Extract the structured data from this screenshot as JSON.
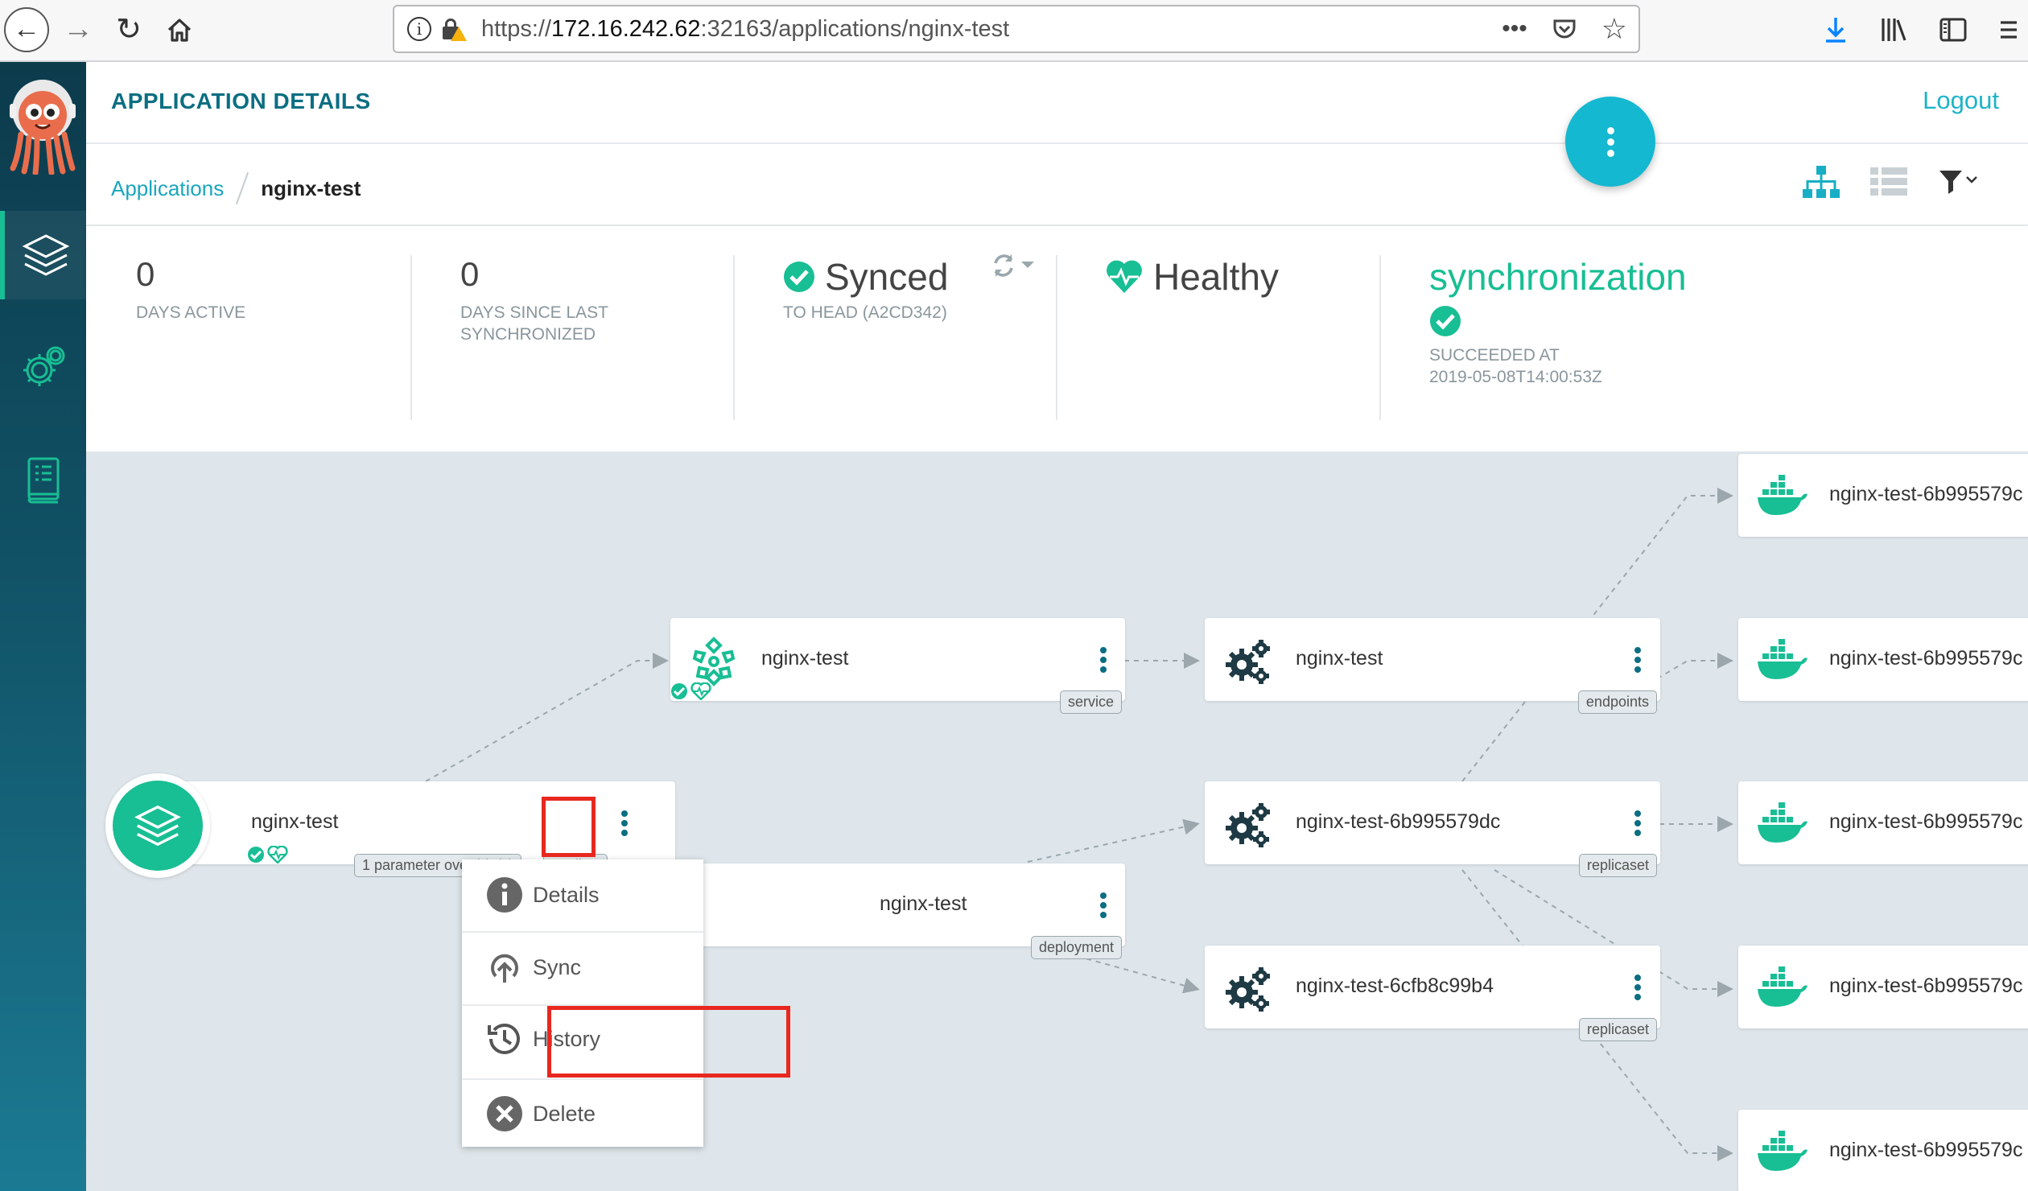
{
  "browser": {
    "url_scheme": "https://",
    "url_host": "172.16.242.62",
    "url_path": ":32163/applications/nginx-test",
    "more_actions": "•••",
    "icons": [
      "back-icon",
      "forward-icon",
      "reload-icon",
      "home-icon",
      "info-icon",
      "insecure-lock-icon",
      "pocket-icon",
      "bookmark-star-icon",
      "download-icon",
      "library-icon",
      "sidebar-icon",
      "menu-icon"
    ]
  },
  "sidebar": {
    "items": [
      {
        "name": "applications",
        "icon": "layers-icon",
        "active": true
      },
      {
        "name": "settings",
        "icon": "gear-icon",
        "active": false
      },
      {
        "name": "docs",
        "icon": "book-icon",
        "active": false
      }
    ]
  },
  "header": {
    "title": "APPLICATION DETAILS",
    "logout": "Logout"
  },
  "breadcrumb": {
    "applications": "Applications",
    "current": "nginx-test"
  },
  "status": {
    "days_active": {
      "value": "0",
      "label": "DAYS ACTIVE"
    },
    "days_since_sync": {
      "value": "0",
      "label": "DAYS SINCE LAST SYNCHRONIZED"
    },
    "sync": {
      "value": "Synced",
      "label": "TO HEAD (A2CD342)"
    },
    "health": {
      "value": "Healthy"
    },
    "operation": {
      "title": "synchronization",
      "label": "SUCCEEDED AT",
      "timestamp": "2019-05-08T14:00:53Z"
    }
  },
  "graph": {
    "root": {
      "name": "nginx-test",
      "tags": [
        "1 parameter override(s)",
        "applica"
      ]
    },
    "nodes": [
      {
        "id": "svc",
        "name": "nginx-test",
        "kind": "service"
      },
      {
        "id": "deploy",
        "name": "nginx-test",
        "kind": "deployment"
      },
      {
        "id": "endpoints",
        "name": "nginx-test",
        "kind": "endpoints"
      },
      {
        "id": "rs1",
        "name": "nginx-test-6b995579dc",
        "kind": "replicaset"
      },
      {
        "id": "rs2",
        "name": "nginx-test-6cfb8c99b4",
        "kind": "replicaset"
      },
      {
        "id": "pod1",
        "name": "nginx-test-6b995579c"
      },
      {
        "id": "pod2",
        "name": "nginx-test-6b995579c"
      },
      {
        "id": "pod3",
        "name": "nginx-test-6b995579c"
      },
      {
        "id": "pod4",
        "name": "nginx-test-6b995579c"
      },
      {
        "id": "pod5",
        "name": "nginx-test-6b995579c"
      }
    ]
  },
  "context_menu": {
    "items": [
      {
        "label": "Details",
        "icon": "info-circle-icon"
      },
      {
        "label": "Sync",
        "icon": "sync-upload-icon"
      },
      {
        "label": "History",
        "icon": "history-icon"
      },
      {
        "label": "Delete",
        "icon": "delete-circle-icon"
      }
    ]
  },
  "colors": {
    "accent": "#18be94",
    "link": "#1db4c9",
    "title": "#0b6e82",
    "highlight": "#e8281f",
    "graph_bg": "#dee6eb"
  }
}
